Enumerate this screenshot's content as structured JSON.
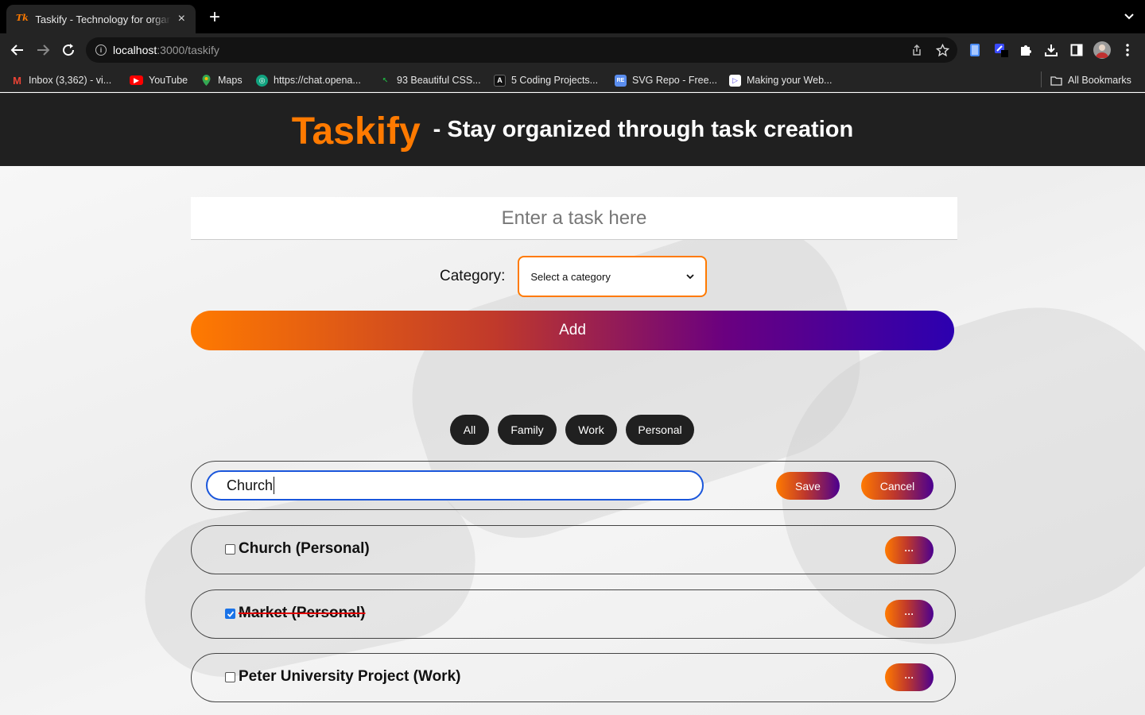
{
  "browser": {
    "tab_title": "Taskify - Technology for organizing tasks",
    "tab_favicon": "Tk",
    "url_host": "localhost",
    "url_path": ":3000/taskify",
    "bookmarks": [
      {
        "label": "Inbox (3,362) - vi...",
        "icon": "gmail-icon",
        "color": "#ea4335"
      },
      {
        "label": "YouTube",
        "icon": "youtube-icon",
        "color": "#ff0000"
      },
      {
        "label": "Maps",
        "icon": "maps-icon",
        "color": "#34a853"
      },
      {
        "label": "https://chat.opena...",
        "icon": "openai-icon",
        "color": "#10a37f"
      },
      {
        "label": "93 Beautiful CSS...",
        "icon": "css-icon",
        "color": "#1fb141"
      },
      {
        "label": "5 Coding Projects...",
        "icon": "coding-icon",
        "color": "#111111"
      },
      {
        "label": "SVG Repo - Free...",
        "icon": "svgrepo-icon",
        "color": "#5a8dee"
      },
      {
        "label": "Making your Web...",
        "icon": "web-icon",
        "color": "#5b4ce0"
      }
    ],
    "all_bookmarks": "All Bookmarks"
  },
  "app": {
    "brand": "Taskify",
    "tagline": "- Stay organized through task creation",
    "task_placeholder": "Enter a task here",
    "category_label": "Category:",
    "category_selected": "Select a category",
    "add_label": "Add",
    "filters": [
      "All",
      "Family",
      "Work",
      "Personal"
    ],
    "editing": {
      "value": "Church",
      "save_label": "Save",
      "cancel_label": "Cancel"
    },
    "tasks": [
      {
        "text": "Church (Personal)",
        "done": false,
        "menu": "···"
      },
      {
        "text": "Market (Personal)",
        "done": true,
        "menu": "···"
      },
      {
        "text": "Peter University Project (Work)",
        "done": false,
        "menu": "···"
      }
    ],
    "colors": {
      "accent": "#ff7a00",
      "header_bg": "#202020",
      "gradient_end": "#2c00b0"
    }
  }
}
